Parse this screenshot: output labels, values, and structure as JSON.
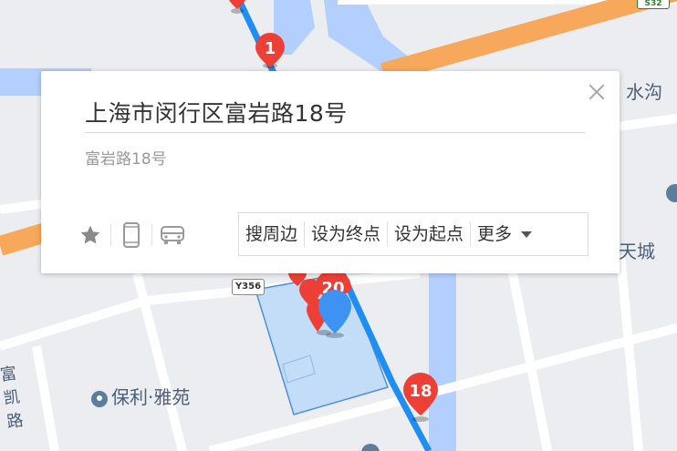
{
  "map": {
    "labels": {
      "shuigou": "水沟",
      "tiancheng": "天城",
      "poi_name": "保利·雅苑",
      "road_fukai": "富凯路"
    },
    "road_shield": "Y356",
    "road_shield_top": "S32",
    "markers": [
      "1",
      "20",
      "18"
    ],
    "colors": {
      "background": "#ecedf0",
      "water": "#b3cffd",
      "highway": "#f7a85b",
      "route": "#1e8ef0",
      "marker": "#ed3f36",
      "location_pin": "#3c93f2",
      "area_fill": "#c3dcf8"
    }
  },
  "popup": {
    "title": "上海市闵行区富岩路18号",
    "subtitle": "富岩路18号",
    "icons": [
      "star-icon",
      "phone-icon",
      "car-icon"
    ],
    "actions": {
      "search_nearby": "搜周边",
      "set_destination": "设为终点",
      "set_start": "设为起点",
      "more": "更多"
    }
  }
}
